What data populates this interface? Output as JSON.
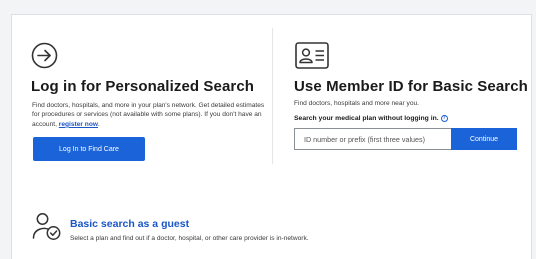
{
  "colors": {
    "primary": "#1a63d8",
    "link": "#1a56c6",
    "icon_stroke": "#333333",
    "background": "#f3f4f6"
  },
  "login": {
    "icon": "sign-in-arrow-icon",
    "title": "Log in for Personalized Search",
    "description": "Find doctors, hospitals, and more in your plan's network. Get detailed estimates for procedures or services (not available with some plans). If you don't have an account,",
    "register_link": "register now",
    "register_suffix": ".",
    "button_label": "Log In to Find Care"
  },
  "member": {
    "icon": "id-card-icon",
    "title": "Use Member ID for Basic Search",
    "description": "Find doctors, hospitals and more near you.",
    "search_label": "Search your medical plan without logging in.",
    "help_icon": "help-circle-icon",
    "input_placeholder": "ID number or prefix (first three values)",
    "input_value": "",
    "button_label": "Continue"
  },
  "guest": {
    "icon": "person-check-icon",
    "title": "Basic search as a guest",
    "description": "Select a plan and find out if a doctor, hospital, or other care provider is in-network."
  }
}
